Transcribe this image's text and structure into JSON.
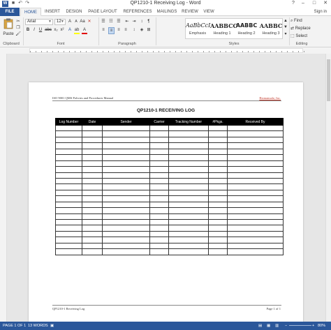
{
  "window": {
    "title": "QP1210-1 Receiving Log - Word",
    "app_icon": "W",
    "minimize": "–",
    "maximize": "□",
    "close": "✕",
    "help": "?"
  },
  "tabs": [
    "FILE",
    "HOME",
    "INSERT",
    "DESIGN",
    "PAGE LAYOUT",
    "REFERENCES",
    "MAILINGS",
    "REVIEW",
    "VIEW"
  ],
  "sign_in": "Sign in",
  "ribbon": {
    "clipboard": {
      "paste": "Paste",
      "label": "Clipboard"
    },
    "font": {
      "name": "Arial",
      "size": "12",
      "label": "Font"
    },
    "paragraph": {
      "label": "Paragraph"
    },
    "styles": {
      "label": "Styles",
      "items": [
        {
          "sample": "AaBbCcI",
          "name": "Emphasis"
        },
        {
          "sample": "AABBCC",
          "name": "Heading 1"
        },
        {
          "sample": "AABBC",
          "name": "Heading 2"
        },
        {
          "sample": "AABBC",
          "name": "Heading 3"
        }
      ]
    },
    "editing": {
      "find": "Find",
      "replace": "Replace",
      "select": "Select",
      "label": "Editing"
    }
  },
  "document": {
    "header_left": "ISO 9001 QMS Policies and Procedures Manual",
    "header_right": "Bizmanualz, Inc.",
    "heading": "QP1210-1 RECEIVING LOG",
    "columns": [
      "Log Number",
      "Date",
      "Sender",
      "Carrier",
      "Tracking Number",
      "#Pkgs.",
      "Received By"
    ],
    "row_count": 22,
    "footer_left": "QP1210-1 Receiving Log",
    "footer_right": "Page 1 of 1"
  },
  "status": {
    "page": "PAGE 1 OF 1",
    "words": "13 WORDS",
    "zoom": "80%"
  },
  "colors": {
    "accent": "#2b579a",
    "table_header": "#000000"
  }
}
